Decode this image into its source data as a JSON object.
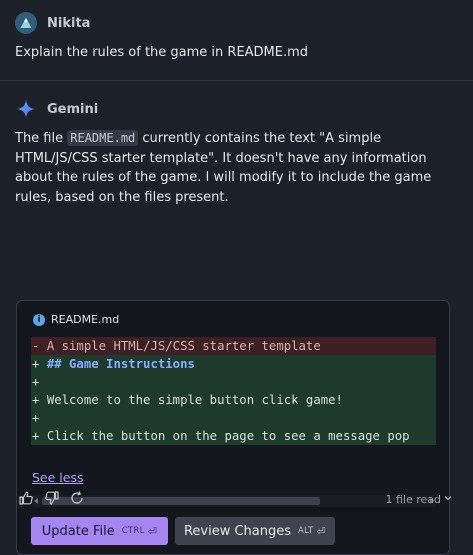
{
  "user": {
    "name": "Nikita",
    "message": "Explain the rules of the game in README.md"
  },
  "assistant": {
    "name": "Gemini",
    "text_pre": "The file ",
    "inline_code": "README.md",
    "text_post": " currently contains the text \"A simple HTML/JS/CSS starter template\". It doesn't have any information about the rules of the game. I will modify it to include the game rules, based on the files present."
  },
  "diff": {
    "file_name": "README.md",
    "lines": [
      {
        "type": "del",
        "prefix": "- ",
        "text": "A simple HTML/JS/CSS starter template"
      },
      {
        "type": "add",
        "prefix": "+ ",
        "text": "## Game Instructions",
        "heading": true
      },
      {
        "type": "add",
        "prefix": "+",
        "text": ""
      },
      {
        "type": "add",
        "prefix": "+ ",
        "text": "Welcome to the simple button click game!"
      },
      {
        "type": "add",
        "prefix": "+",
        "text": ""
      },
      {
        "type": "add",
        "prefix": "+ ",
        "text": "Click the button on the page to see a message pop"
      }
    ],
    "see_less_label": "See less",
    "update_button_label": "Update File",
    "update_shortcut": "CTRL",
    "review_button_label": "Review Changes",
    "review_shortcut": "ALT"
  },
  "footer": {
    "files_read": "1 file read"
  },
  "colors": {
    "background": "#1c2029",
    "primary_button": "#a585f0",
    "deleted_line": "#3d1f24",
    "added_line": "#1d3a2d",
    "link": "#b69cf5"
  }
}
